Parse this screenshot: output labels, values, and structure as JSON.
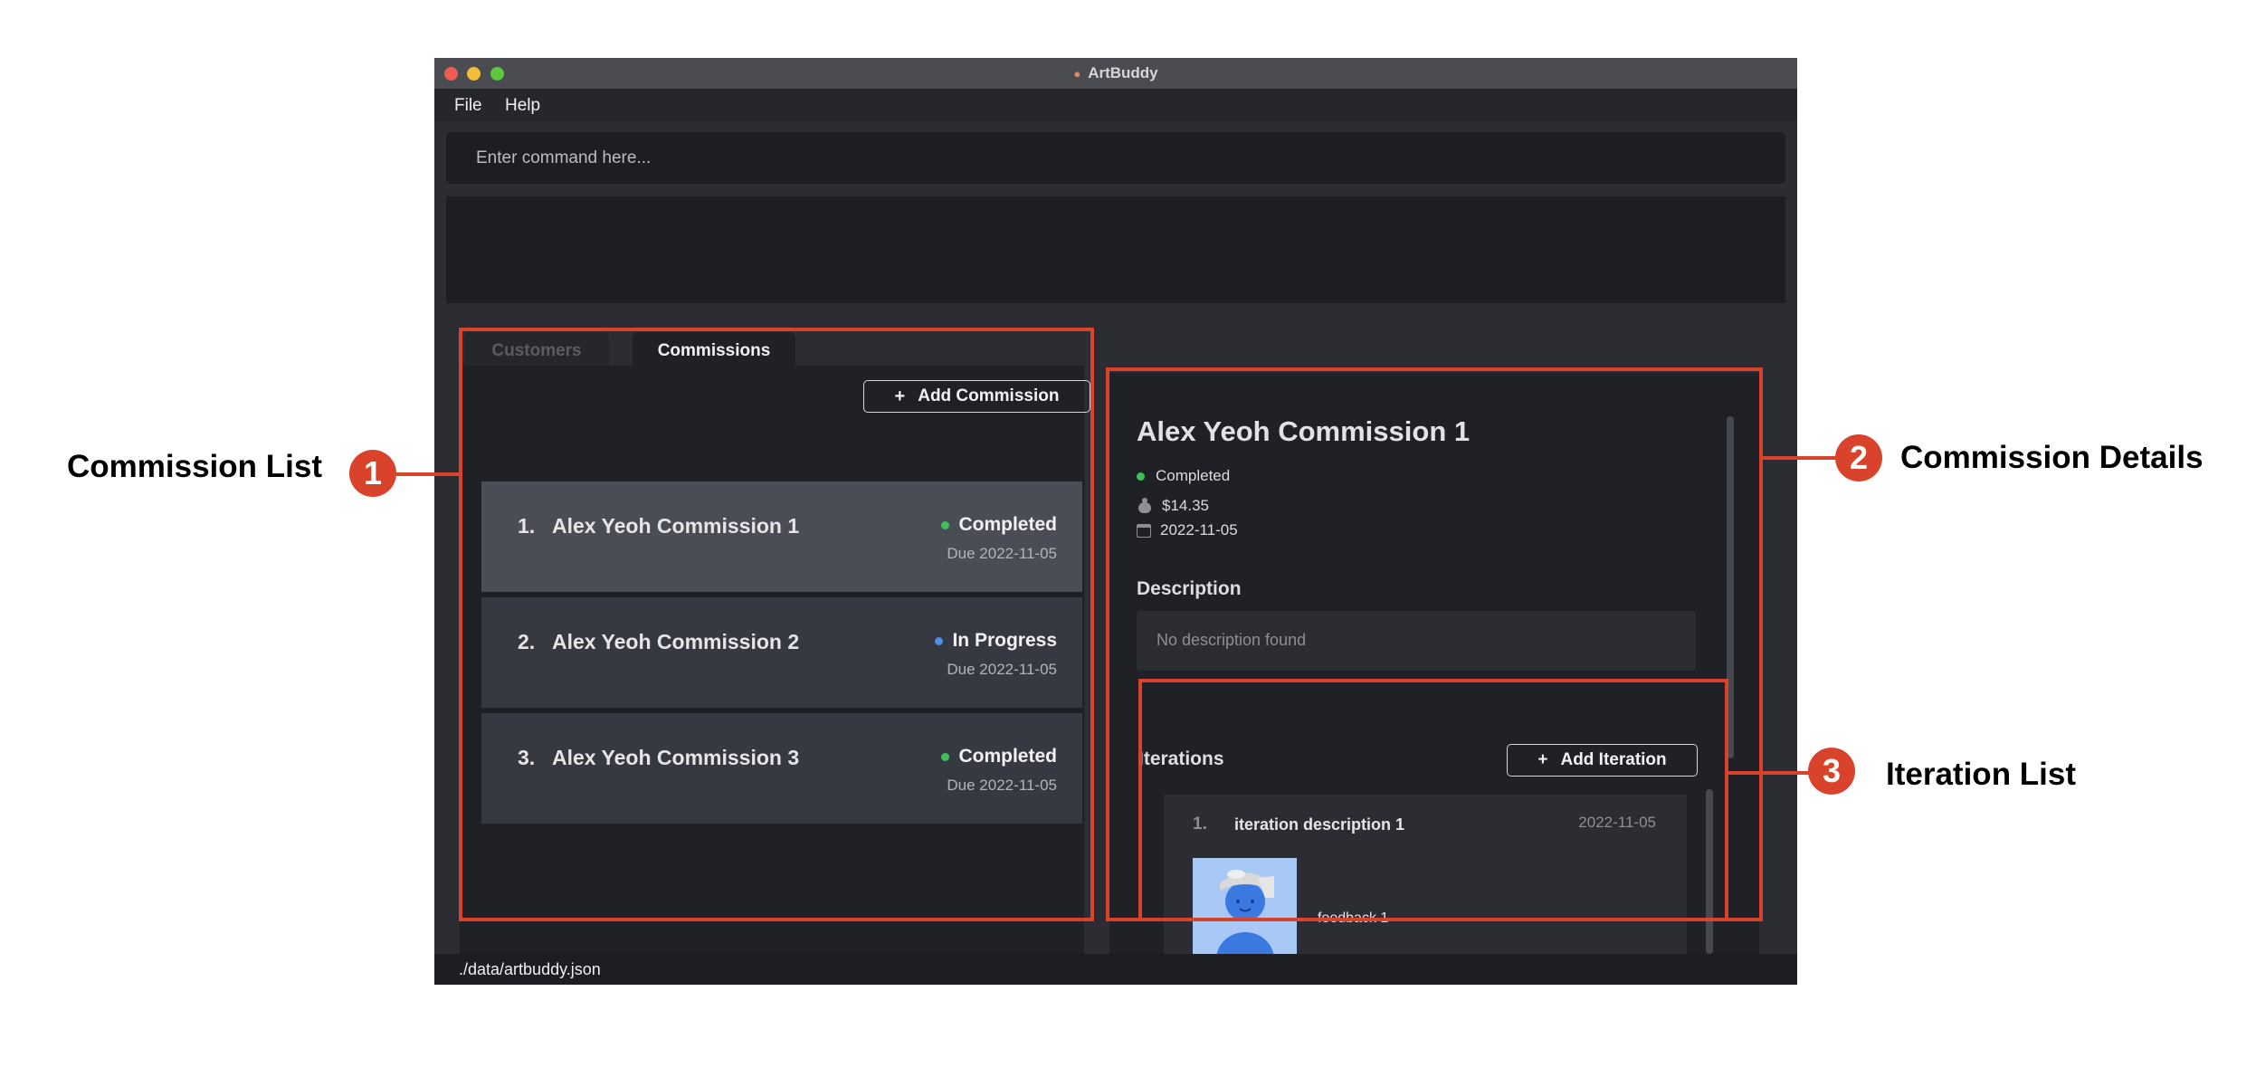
{
  "window": {
    "title": "ArtBuddy"
  },
  "menu": {
    "file": "File",
    "help": "Help"
  },
  "command": {
    "placeholder": "Enter command here..."
  },
  "tabs": {
    "customers": "Customers",
    "commissions": "Commissions"
  },
  "commission_list": {
    "add_button": "Add Commission",
    "items": [
      {
        "index": "1.",
        "title": "Alex Yeoh Commission 1",
        "status": "Completed",
        "due": "Due 2022-11-05"
      },
      {
        "index": "2.",
        "title": "Alex Yeoh Commission 2",
        "status": "In Progress",
        "due": "Due 2022-11-05"
      },
      {
        "index": "3.",
        "title": "Alex Yeoh Commission 3",
        "status": "Completed",
        "due": "Due 2022-11-05"
      }
    ]
  },
  "details": {
    "title": "Alex Yeoh Commission 1",
    "status": "Completed",
    "price": "$14.35",
    "date": "2022-11-05",
    "description_label": "Description",
    "description": "No description found",
    "iterations_label": "Iterations",
    "add_iteration_button": "Add Iteration",
    "iterations": [
      {
        "index": "1.",
        "description": "iteration description 1",
        "date": "2022-11-05",
        "feedback": "feedback 1"
      }
    ]
  },
  "status_bar": {
    "path": "./data/artbuddy.json"
  },
  "annotations": {
    "one": {
      "number": "1",
      "label": "Commission List"
    },
    "two": {
      "number": "2",
      "label": "Commission Details"
    },
    "three": {
      "number": "3",
      "label": "Iteration List"
    }
  },
  "colors": {
    "annotation": "#d9432c",
    "completed": "#3fc15a",
    "in_progress": "#4e8dea"
  }
}
